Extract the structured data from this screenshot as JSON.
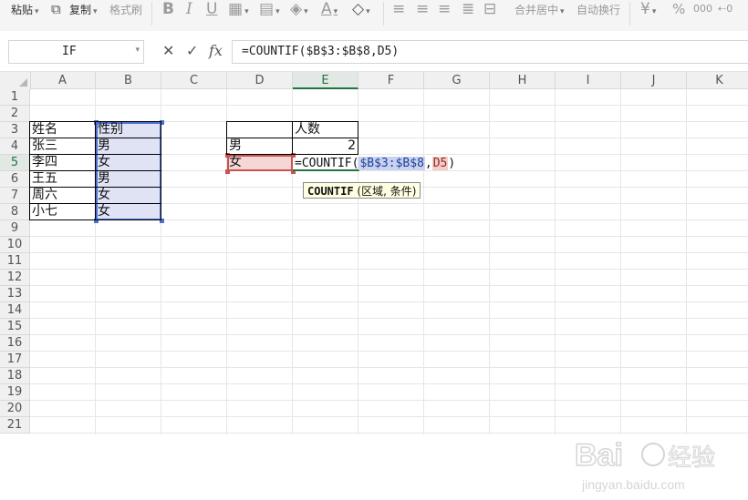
{
  "toolbar": {
    "paste": "粘贴",
    "copy": "复制",
    "format_painter": "格式刷",
    "merge_center": "合并居中",
    "wrap_text": "自动换行",
    "currency_symbol": "¥",
    "percent_symbol": "%",
    "bold_symbol": "B",
    "italic_symbol": "I",
    "underline_symbol": "U",
    "font_color_symbol": "A"
  },
  "formula_bar": {
    "name_box": "IF",
    "cancel_symbol": "✕",
    "confirm_symbol": "✓",
    "fx_symbol": "fx",
    "formula": "=COUNTIF($B$3:$B$8,D5)"
  },
  "sheet": {
    "columns": [
      "A",
      "B",
      "C",
      "D",
      "E",
      "F",
      "G",
      "H",
      "I",
      "J",
      "K"
    ],
    "active_column": "E",
    "rows": [
      "1",
      "2",
      "3",
      "4",
      "5",
      "6",
      "7",
      "8",
      "9",
      "10",
      "11",
      "12",
      "13",
      "14",
      "15",
      "16",
      "17",
      "18",
      "19",
      "20",
      "21"
    ],
    "active_row": "5",
    "cells": {
      "A3": "姓名",
      "B3": "性别",
      "A4": "张三",
      "B4": "男",
      "A5": "李四",
      "B5": "女",
      "A6": "王五",
      "B6": "男",
      "A7": "周六",
      "B7": "女",
      "A8": "小七",
      "B8": "女",
      "E3": "人数",
      "D4": "男",
      "E4": "2",
      "D5": "女"
    },
    "edit_cell": {
      "prefix": "=COUNTIF(",
      "ref1": "$B$3:$B$8",
      "comma": ",",
      "ref2": "D5",
      "suffix": ")"
    },
    "tooltip": {
      "func": "COUNTIF",
      "args": " (区域, 条件)"
    }
  },
  "colors": {
    "accent": "#217346",
    "range_blue": "#4a6fcf",
    "range_red": "#c9534e"
  },
  "watermark": {
    "brand": "Bai",
    "brand2": "经验",
    "url": "jingyan.baidu.com"
  }
}
